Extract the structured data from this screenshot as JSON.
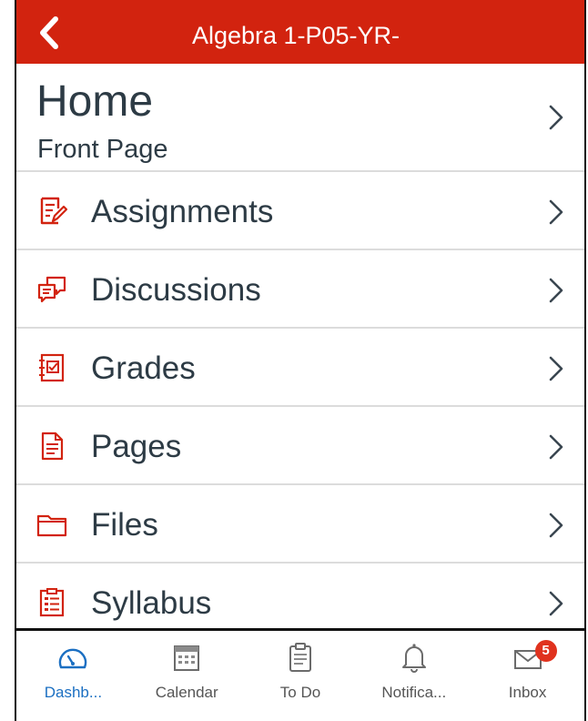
{
  "header": {
    "title": "Algebra 1-P05-YR-"
  },
  "home": {
    "title": "Home",
    "subtitle": "Front Page"
  },
  "nav": {
    "items": [
      {
        "label": "Assignments",
        "icon": "assignments-icon"
      },
      {
        "label": "Discussions",
        "icon": "discussions-icon"
      },
      {
        "label": "Grades",
        "icon": "grades-icon"
      },
      {
        "label": "Pages",
        "icon": "pages-icon"
      },
      {
        "label": "Files",
        "icon": "folder-icon"
      },
      {
        "label": "Syllabus",
        "icon": "syllabus-icon"
      }
    ]
  },
  "tabbar": {
    "tabs": [
      {
        "label": "Dashb...",
        "icon": "dashboard-icon",
        "active": true
      },
      {
        "label": "Calendar",
        "icon": "calendar-icon",
        "active": false
      },
      {
        "label": "To Do",
        "icon": "todo-icon",
        "active": false
      },
      {
        "label": "Notifica...",
        "icon": "bell-icon",
        "active": false
      },
      {
        "label": "Inbox",
        "icon": "inbox-icon",
        "active": false,
        "badge": "5"
      }
    ]
  },
  "colors": {
    "brand": "#d2230f",
    "text": "#2d3b45",
    "active_tab": "#1b6fc2",
    "badge": "#e0321e"
  }
}
